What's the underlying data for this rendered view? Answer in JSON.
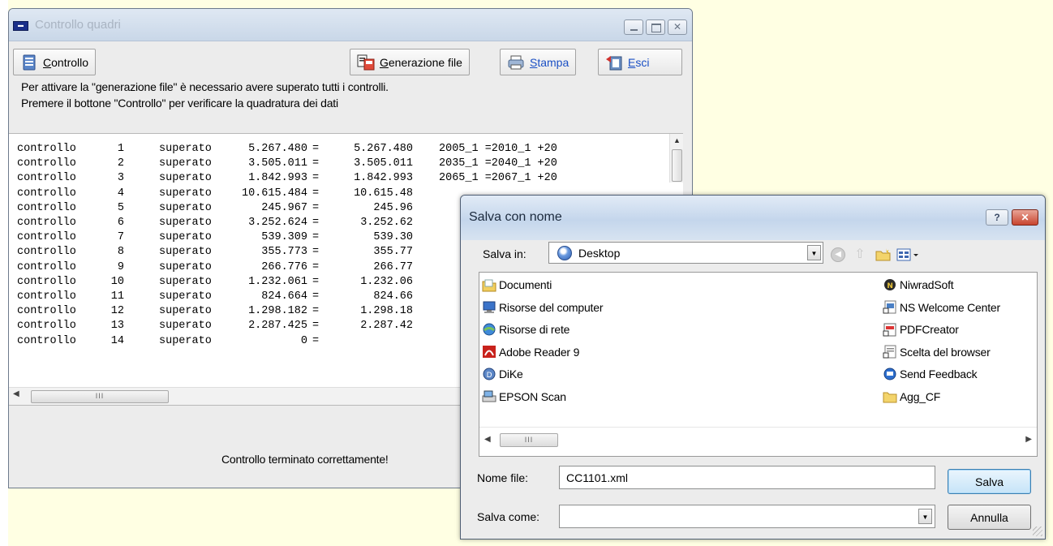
{
  "main_window": {
    "title": "Controllo quadri",
    "toolbar": {
      "controllo": "Controllo",
      "generazione": "Generazione file",
      "stampa": "Stampa",
      "esci": "Esci"
    },
    "info_line1": "Per attivare la \"generazione file\" è necessario avere superato tutti i controlli.",
    "info_line2": "Premere il bottone \"Controllo\"  per verificare la quadratura dei dati",
    "log_rows": [
      {
        "name": "controllo",
        "num": "1",
        "status": "superato",
        "a": "5.267.480",
        "eq": "=",
        "b": "5.267.480",
        "formula": "2005_1 =2010_1 +20"
      },
      {
        "name": "controllo",
        "num": "2",
        "status": "superato",
        "a": "3.505.011",
        "eq": "=",
        "b": "3.505.011",
        "formula": "2035_1 =2040_1 +20"
      },
      {
        "name": "controllo",
        "num": "3",
        "status": "superato",
        "a": "1.842.993",
        "eq": "=",
        "b": "1.842.993",
        "formula": "2065_1 =2067_1 +20"
      },
      {
        "name": "controllo",
        "num": "4",
        "status": "superato",
        "a": "10.615.484",
        "eq": "=",
        "b": "10.615.48",
        "formula": ""
      },
      {
        "name": "controllo",
        "num": "5",
        "status": "superato",
        "a": "245.967",
        "eq": "=",
        "b": "245.96",
        "formula": ""
      },
      {
        "name": "controllo",
        "num": "6",
        "status": "superato",
        "a": "3.252.624",
        "eq": "=",
        "b": "3.252.62",
        "formula": ""
      },
      {
        "name": "controllo",
        "num": "7",
        "status": "superato",
        "a": "539.309",
        "eq": "=",
        "b": "539.30",
        "formula": ""
      },
      {
        "name": "controllo",
        "num": "8",
        "status": "superato",
        "a": "355.773",
        "eq": "=",
        "b": "355.77",
        "formula": ""
      },
      {
        "name": "controllo",
        "num": "9",
        "status": "superato",
        "a": "266.776",
        "eq": "=",
        "b": "266.77",
        "formula": ""
      },
      {
        "name": "controllo",
        "num": "10",
        "status": "superato",
        "a": "1.232.061",
        "eq": "=",
        "b": "1.232.06",
        "formula": ""
      },
      {
        "name": "controllo",
        "num": "11",
        "status": "superato",
        "a": "824.664",
        "eq": "=",
        "b": "824.66",
        "formula": ""
      },
      {
        "name": "controllo",
        "num": "12",
        "status": "superato",
        "a": "1.298.182",
        "eq": "=",
        "b": "1.298.18",
        "formula": ""
      },
      {
        "name": "controllo",
        "num": "13",
        "status": "superato",
        "a": "2.287.425",
        "eq": "=",
        "b": "2.287.42",
        "formula": ""
      },
      {
        "name": "controllo",
        "num": "14",
        "status": "superato",
        "a": "0",
        "eq": "=",
        "b": "",
        "formula": ""
      }
    ],
    "status_message": "Controllo terminato correttamente!"
  },
  "save_dialog": {
    "title": "Salva con nome",
    "help_label": "?",
    "close_label": "✕",
    "save_in_label": "Salva in:",
    "save_in_value": "Desktop",
    "files_left": [
      {
        "label": "Documenti",
        "icon": "folder-documents-icon"
      },
      {
        "label": "Risorse del computer",
        "icon": "computer-icon"
      },
      {
        "label": "Risorse di rete",
        "icon": "network-icon"
      },
      {
        "label": "Adobe Reader 9",
        "icon": "adobe-reader-icon"
      },
      {
        "label": "DiKe",
        "icon": "dike-icon"
      },
      {
        "label": "EPSON Scan",
        "icon": "scanner-icon"
      }
    ],
    "files_right": [
      {
        "label": "NiwradSoft",
        "icon": "niwradsoft-icon"
      },
      {
        "label": "NS Welcome Center",
        "icon": "shortcut-icon"
      },
      {
        "label": "PDFCreator",
        "icon": "pdfcreator-icon"
      },
      {
        "label": "Scelta del browser",
        "icon": "browser-choice-icon"
      },
      {
        "label": "Send Feedback",
        "icon": "feedback-icon"
      },
      {
        "label": "Agg_CF",
        "icon": "folder-icon"
      }
    ],
    "file_name_label": "Nome file:",
    "file_name_value": "CC1101.xml",
    "file_type_label": "Salva come:",
    "file_type_value": "",
    "save_button": "Salva",
    "cancel_button": "Annulla"
  },
  "colors": {
    "desktop": "#ffffe3",
    "window_bg": "#ececec",
    "link_blue": "#1a4fc4"
  }
}
